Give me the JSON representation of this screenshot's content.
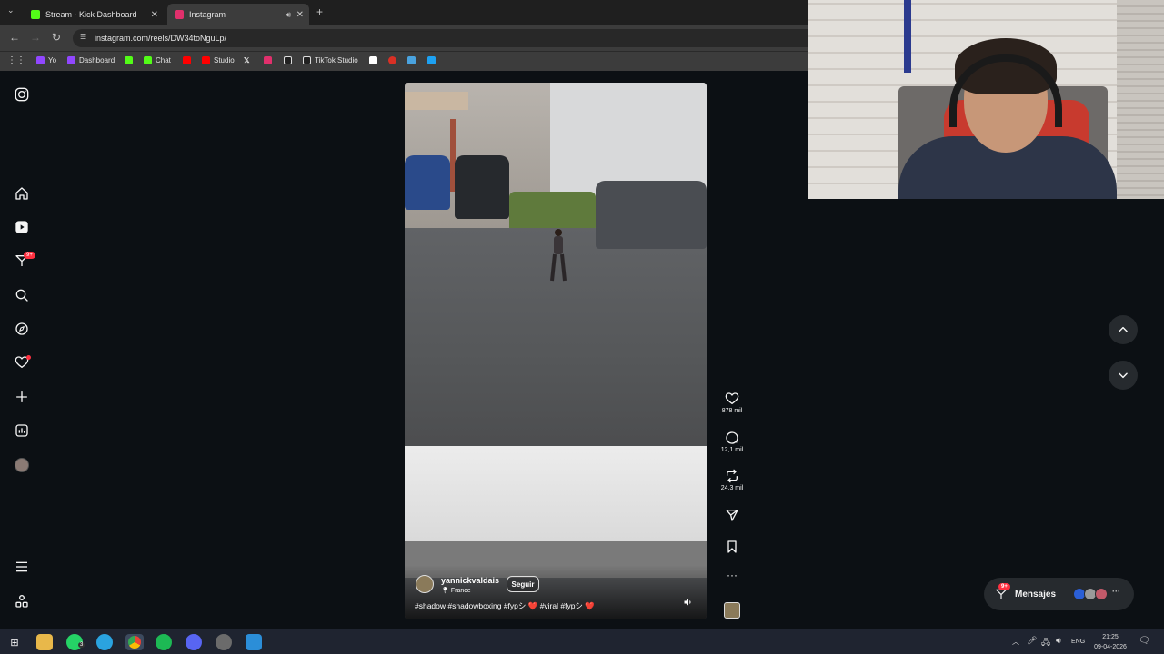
{
  "browser": {
    "tabs": [
      {
        "title": "Stream - Kick Dashboard",
        "favicon_color": "#53fc18"
      },
      {
        "title": "Instagram",
        "favicon_color": "#e1306c"
      }
    ],
    "url": "instagram.com/reels/DW34toNguLp/",
    "bookmarks": [
      {
        "label": "Yo",
        "color": "#9147ff"
      },
      {
        "label": "Dashboard",
        "color": "#9147ff"
      },
      {
        "label": "",
        "color": "#53fc18"
      },
      {
        "label": "Chat",
        "color": "#53fc18"
      },
      {
        "label": "",
        "color": "#ff0000"
      },
      {
        "label": "Studio",
        "color": "#ff0000"
      },
      {
        "label": "",
        "color": "#ffffff"
      },
      {
        "label": "",
        "color": "#e1306c"
      },
      {
        "label": "",
        "color": "#ffffff"
      },
      {
        "label": "TikTok Studio",
        "color": "#ffffff"
      }
    ]
  },
  "sidebar": {
    "notifications_badge": "9+"
  },
  "reel": {
    "author": "yannickvaldais",
    "location": "France",
    "follow_label": "Seguir",
    "caption": "#shadow #shadowboxing #fypシ ❤️ #viral #fypシ ❤️",
    "likes": "878 mil",
    "comments": "12,1 mil",
    "reposts": "24,3 mil"
  },
  "messages": {
    "label": "Mensajes",
    "badge": "9+"
  },
  "taskbar": {
    "whatsapp_badge": "3",
    "language": "ENG",
    "time": "21:25",
    "date": "09-04-2026"
  }
}
